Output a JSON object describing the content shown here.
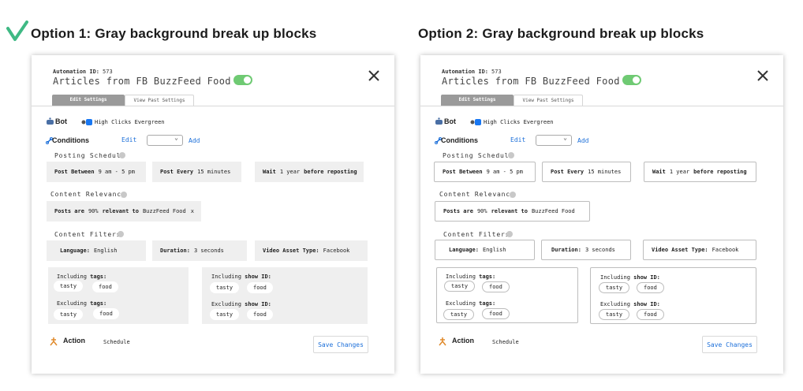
{
  "options": [
    {
      "title": "Option 1: Gray background break up blocks",
      "selected": true
    },
    {
      "title": "Option 2: Gray background break up blocks",
      "selected": false
    }
  ],
  "card": {
    "automation_id_label": "Automation ID:",
    "automation_id_value": "573",
    "title": "Articles from FB BuzzFeed Food",
    "tabs": [
      "Edit Settings",
      "View Past Settings"
    ],
    "bot_label": "Bot",
    "bot_value": "High Clicks Evergreen",
    "conditions_label": "Conditions",
    "edit_label": "Edit",
    "add_label": "Add",
    "posting_schedule_label": "Posting Schedule",
    "post_between_label": "Post Between",
    "post_between_value": "9 am - 5 pm",
    "post_every_label": "Post Every",
    "post_every_value": "15 minutes",
    "wait_label": "Wait",
    "wait_value": "1 year",
    "before_reposting_label": "before reposting",
    "content_relevancy_label": "Content Relevancy",
    "posts_are_label": "Posts are",
    "posts_are_value": "90%",
    "relevant_to_label": "relevant to",
    "relevant_to_value": "BuzzFeed Food",
    "remove_symbol": "x",
    "content_filters_label": "Content Filters",
    "language_label": "Language:",
    "language_value": "English",
    "duration_label": "Duration:",
    "duration_value": "3 seconds",
    "video_asset_label": "Video Asset Type:",
    "video_asset_value": "Facebook",
    "including_word": "Including",
    "excluding_word": "Excluding",
    "tags_label": "tags:",
    "show_id_label": "show ID:",
    "chip_tasty": "tasty",
    "chip_food": "food",
    "action_label": "Action",
    "action_value": "Schedule",
    "save_label": "Save Changes"
  },
  "colors": {
    "toggle_on": "#6fca73",
    "link": "#1c6fd9",
    "active_tab": "#9a9a9a",
    "block_gray": "#efefef",
    "check": "#3fb984"
  },
  "icons": [
    "checkmark-icon",
    "close-icon",
    "robot-icon",
    "facebook-icon",
    "link-icon",
    "action-icon",
    "info-dot-icon"
  ]
}
